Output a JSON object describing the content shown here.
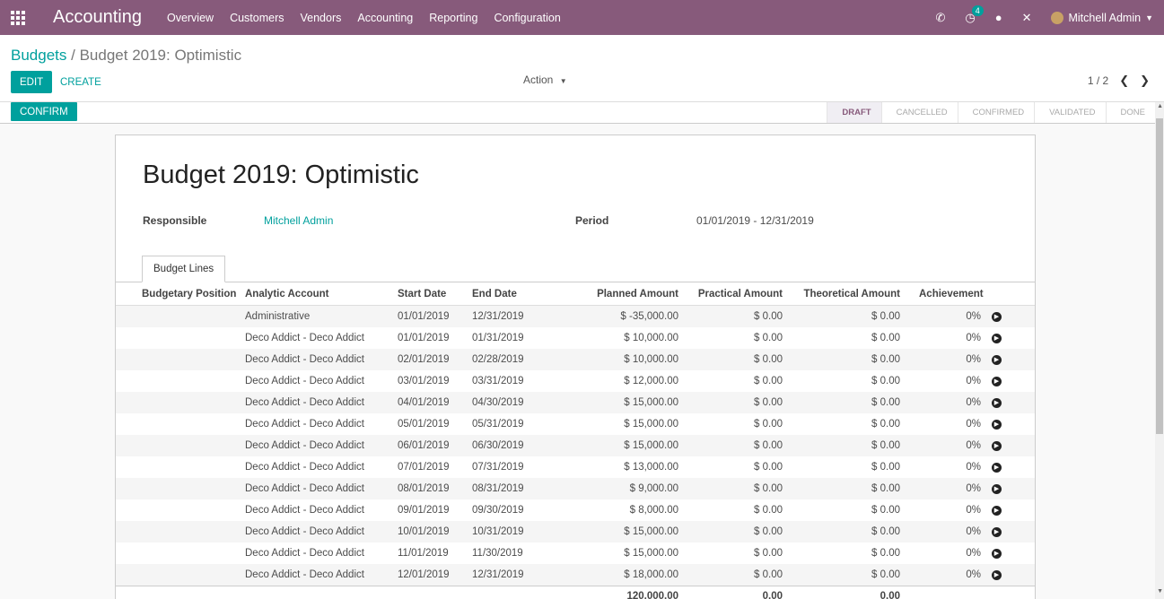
{
  "navbar": {
    "brand": "Accounting",
    "menu": [
      "Overview",
      "Customers",
      "Vendors",
      "Accounting",
      "Reporting",
      "Configuration"
    ],
    "activity_badge": "4",
    "user_name": "Mitchell Admin"
  },
  "control": {
    "breadcrumb_parent": "Budgets",
    "breadcrumb_sep": "/",
    "breadcrumb_current": "Budget 2019: Optimistic",
    "edit_label": "EDIT",
    "create_label": "CREATE",
    "action_label": "Action",
    "pager_text": "1 / 2"
  },
  "statusbar": {
    "confirm_label": "CONFIRM",
    "stages": [
      "DRAFT",
      "CANCELLED",
      "CONFIRMED",
      "VALIDATED",
      "DONE"
    ],
    "active_stage": "DRAFT"
  },
  "form": {
    "title": "Budget 2019: Optimistic",
    "responsible_label": "Responsible",
    "responsible_value": "Mitchell Admin",
    "period_label": "Period",
    "period_value": "01/01/2019 - 12/31/2019",
    "tab_label": "Budget Lines"
  },
  "table": {
    "headers": [
      "Budgetary Position",
      "Analytic Account",
      "Start Date",
      "End Date",
      "Planned Amount",
      "Practical Amount",
      "Theoretical Amount",
      "Achievement"
    ],
    "rows": [
      [
        "",
        "Administrative",
        "01/01/2019",
        "12/31/2019",
        "$ -35,000.00",
        "$ 0.00",
        "$ 0.00",
        "0%"
      ],
      [
        "",
        "Deco Addict - Deco Addict",
        "01/01/2019",
        "01/31/2019",
        "$ 10,000.00",
        "$ 0.00",
        "$ 0.00",
        "0%"
      ],
      [
        "",
        "Deco Addict - Deco Addict",
        "02/01/2019",
        "02/28/2019",
        "$ 10,000.00",
        "$ 0.00",
        "$ 0.00",
        "0%"
      ],
      [
        "",
        "Deco Addict - Deco Addict",
        "03/01/2019",
        "03/31/2019",
        "$ 12,000.00",
        "$ 0.00",
        "$ 0.00",
        "0%"
      ],
      [
        "",
        "Deco Addict - Deco Addict",
        "04/01/2019",
        "04/30/2019",
        "$ 15,000.00",
        "$ 0.00",
        "$ 0.00",
        "0%"
      ],
      [
        "",
        "Deco Addict - Deco Addict",
        "05/01/2019",
        "05/31/2019",
        "$ 15,000.00",
        "$ 0.00",
        "$ 0.00",
        "0%"
      ],
      [
        "",
        "Deco Addict - Deco Addict",
        "06/01/2019",
        "06/30/2019",
        "$ 15,000.00",
        "$ 0.00",
        "$ 0.00",
        "0%"
      ],
      [
        "",
        "Deco Addict - Deco Addict",
        "07/01/2019",
        "07/31/2019",
        "$ 13,000.00",
        "$ 0.00",
        "$ 0.00",
        "0%"
      ],
      [
        "",
        "Deco Addict - Deco Addict",
        "08/01/2019",
        "08/31/2019",
        "$ 9,000.00",
        "$ 0.00",
        "$ 0.00",
        "0%"
      ],
      [
        "",
        "Deco Addict - Deco Addict",
        "09/01/2019",
        "09/30/2019",
        "$ 8,000.00",
        "$ 0.00",
        "$ 0.00",
        "0%"
      ],
      [
        "",
        "Deco Addict - Deco Addict",
        "10/01/2019",
        "10/31/2019",
        "$ 15,000.00",
        "$ 0.00",
        "$ 0.00",
        "0%"
      ],
      [
        "",
        "Deco Addict - Deco Addict",
        "11/01/2019",
        "11/30/2019",
        "$ 15,000.00",
        "$ 0.00",
        "$ 0.00",
        "0%"
      ],
      [
        "",
        "Deco Addict - Deco Addict",
        "12/01/2019",
        "12/31/2019",
        "$ 18,000.00",
        "$ 0.00",
        "$ 0.00",
        "0%"
      ]
    ],
    "totals": [
      "",
      "",
      "",
      "",
      "120,000.00",
      "0.00",
      "0.00",
      ""
    ]
  },
  "colors": {
    "navbar": "#875a7b",
    "accent": "#00a09d"
  },
  "icons": {
    "apps": "apps-grid-icon",
    "phone": "phone-icon",
    "activity": "clock-icon",
    "chat": "chat-icon",
    "close": "close-icon",
    "row_action": "arrow-circle-right-icon"
  }
}
